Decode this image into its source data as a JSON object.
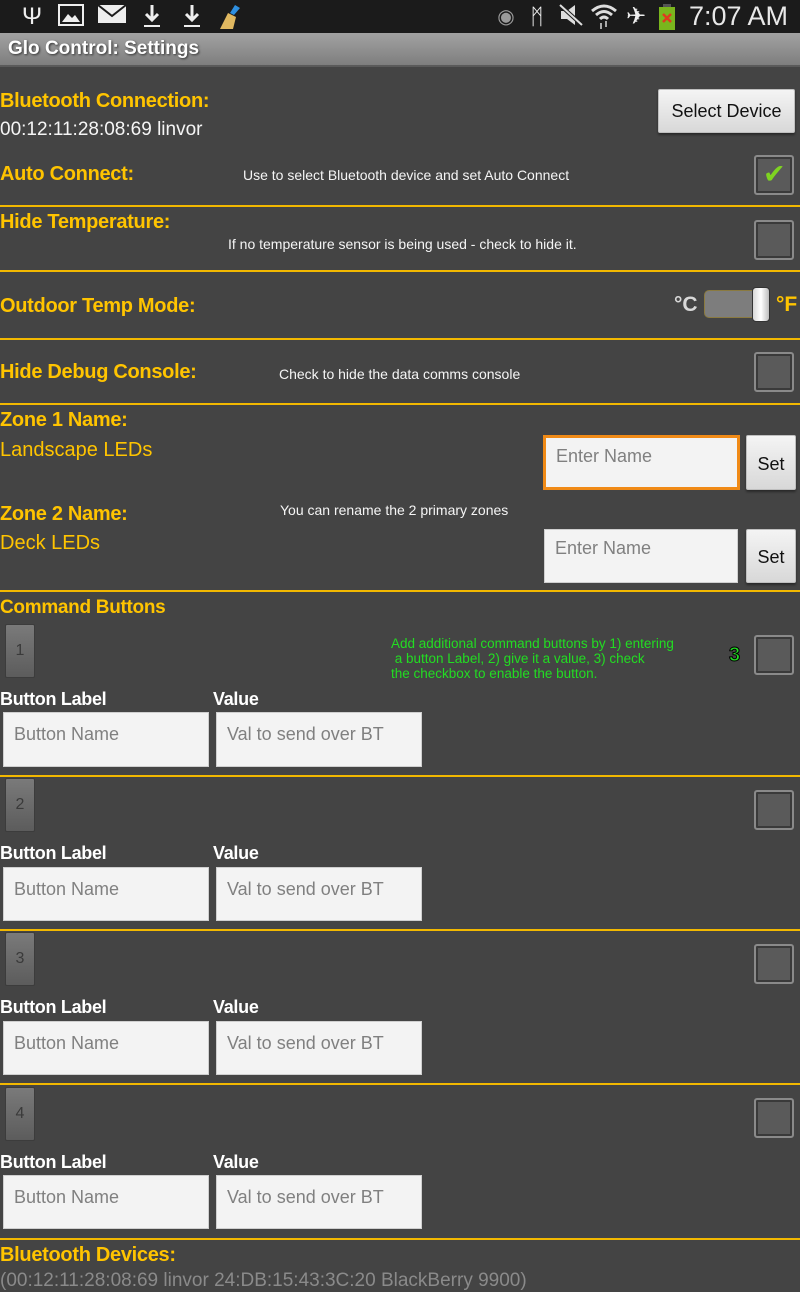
{
  "status_bar": {
    "left_icons": [
      "usb-icon",
      "gallery-icon",
      "mail-icon",
      "download-icon",
      "download-icon",
      "cleaner-broom-icon"
    ],
    "right_icons": [
      "eye-icon",
      "bluetooth-icon",
      "mute-icon",
      "wifi-icon",
      "airplane-icon",
      "battery-icon"
    ],
    "time": "7:07 AM"
  },
  "app": {
    "title": "Glo Control:  Settings"
  },
  "bluetooth": {
    "label": "Bluetooth Connection:",
    "device": "00:12:11:28:08:69 linvor",
    "select_button": "Select Device"
  },
  "auto_connect": {
    "label": "Auto Connect:",
    "hint": "Use to select Bluetooth device and set Auto Connect",
    "checked": true
  },
  "hide_temperature": {
    "label": "Hide Temperature:",
    "hint": "If no temperature sensor is being used - check to hide it.",
    "checked": false
  },
  "outdoor_temp": {
    "label": "Outdoor Temp Mode:",
    "left_unit": "°C",
    "right_unit": "°F",
    "selected": "°F"
  },
  "hide_debug": {
    "label": "Hide Debug Console:",
    "hint": "Check to hide the data comms console",
    "checked": false
  },
  "zones": {
    "hint": "You can rename the 2 primary zones",
    "items": [
      {
        "label": "Zone 1 Name:",
        "name": "Landscape LEDs",
        "placeholder": "Enter Name",
        "set_label": "Set"
      },
      {
        "label": "Zone 2 Name:",
        "name": "Deck LEDs",
        "placeholder": "Enter Name",
        "set_label": "Set"
      }
    ]
  },
  "command_buttons": {
    "title": "Command Buttons",
    "hint": "Add additional command buttons by 1) entering\n a button Label, 2) give it a value, 3) check\nthe checkbox to enable the button.",
    "label_header": "Button Label",
    "value_header": "Value",
    "markers": [
      "1",
      "2",
      "3"
    ],
    "items": [
      {
        "number": "1",
        "label_placeholder": "Button Name",
        "value_placeholder": "Val to send over BT",
        "enabled": false
      },
      {
        "number": "2",
        "label_placeholder": "Button Name",
        "value_placeholder": "Val to send over BT",
        "enabled": false
      },
      {
        "number": "3",
        "label_placeholder": "Button Name",
        "value_placeholder": "Val to send over BT",
        "enabled": false
      },
      {
        "number": "4",
        "label_placeholder": "Button Name",
        "value_placeholder": "Val to send over BT",
        "enabled": false
      }
    ]
  },
  "bluetooth_devices": {
    "label": "Bluetooth Devices:",
    "list": "(00:12:11:28:08:69 linvor 24:DB:15:43:3C:20 BlackBerry 9900)"
  }
}
